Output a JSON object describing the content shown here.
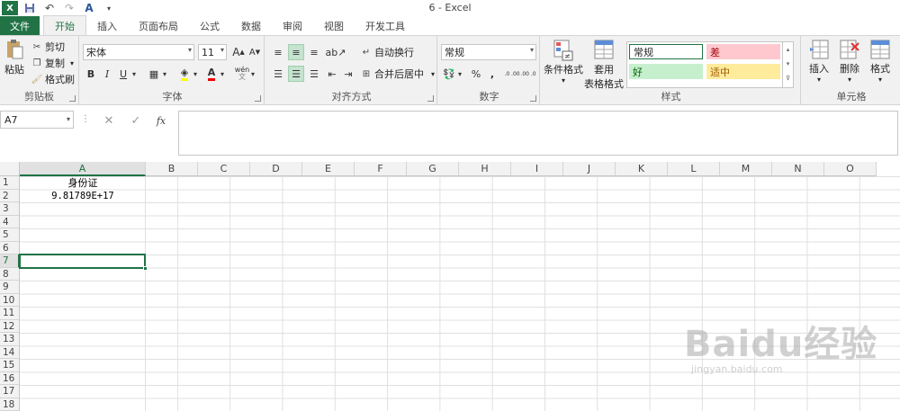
{
  "window": {
    "title": "6 - Excel"
  },
  "qat": {
    "logo": "X",
    "save_icon": "save-icon",
    "undo_icon": "undo-icon",
    "redo_icon": "redo-icon",
    "font_color_icon": "font-color-icon"
  },
  "tabs": [
    {
      "label": "文件"
    },
    {
      "label": "开始"
    },
    {
      "label": "插入"
    },
    {
      "label": "页面布局"
    },
    {
      "label": "公式"
    },
    {
      "label": "数据"
    },
    {
      "label": "审阅"
    },
    {
      "label": "视图"
    },
    {
      "label": "开发工具"
    }
  ],
  "ribbon": {
    "clipboard": {
      "label": "剪贴板",
      "paste": "粘贴",
      "cut": "剪切",
      "copy": "复制",
      "format_painter": "格式刷"
    },
    "font": {
      "label": "字体",
      "font_name": "宋体",
      "font_size": "11",
      "bold": "B",
      "italic": "I",
      "underline": "U",
      "grow": "A",
      "shrink": "A",
      "wen": "wén"
    },
    "alignment": {
      "label": "对齐方式",
      "wrap": "自动换行",
      "merge": "合并后居中"
    },
    "number": {
      "label": "数字",
      "format": "常规",
      "percent": "%",
      "comma": ",",
      "inc": ".0 .00",
      "dec": ".00 .0"
    },
    "styles": {
      "label": "样式",
      "cond_format": "条件格式",
      "table_format_1": "套用",
      "table_format_2": "表格格式",
      "normal": "常规",
      "bad": "差",
      "good": "好",
      "neutral": "适中"
    },
    "cells": {
      "label": "单元格",
      "insert": "插入",
      "delete": "删除",
      "format": "格式"
    }
  },
  "formula_bar": {
    "name_box": "A7",
    "cancel": "✕",
    "enter": "✓",
    "fx": "fx",
    "content": ""
  },
  "columns": [
    "A",
    "B",
    "C",
    "D",
    "E",
    "F",
    "G",
    "H",
    "I",
    "J",
    "K",
    "L",
    "M",
    "N",
    "O"
  ],
  "rows": [
    "1",
    "2",
    "3",
    "4",
    "5",
    "6",
    "7",
    "8",
    "9",
    "10",
    "11",
    "12",
    "13",
    "14",
    "15",
    "16",
    "17",
    "18"
  ],
  "cells": {
    "A1": "身份证",
    "A2": "9.81789E+17"
  },
  "watermark": {
    "main": "Baidu经验",
    "sub": "jingyan.baidu.com"
  },
  "colors": {
    "accent": "#217346",
    "bad_bg": "#ffc7ce",
    "bad_fg": "#9c0006",
    "good_bg": "#c6efce",
    "good_fg": "#006100",
    "neutral_bg": "#ffeb9c",
    "neutral_fg": "#9c5700"
  }
}
